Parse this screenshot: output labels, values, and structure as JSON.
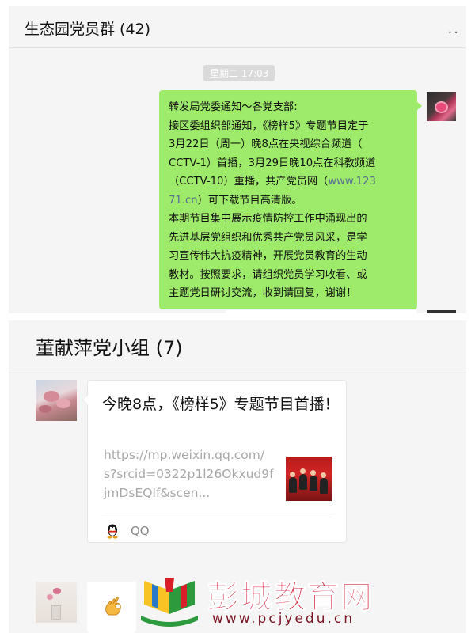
{
  "chat1": {
    "title": "生态园党员群 (42)",
    "more_label": "..",
    "time": "星期二 17:03",
    "message_lines": [
      "转发局党委通知～各党支部:",
      "接区委组织部通知，《榜样5》专题节目定于",
      "3月22日（周一）晚8点在央视综合频道（",
      "CCTV-1）首播，3月29日晚10点在科教频道",
      "（CCTV-10）重播，共产党员网（"
    ],
    "link_part1": "www.123",
    "link_part2": "71.cn",
    "message_after_link": "）可下载节目高清版。",
    "message_lines2": [
      "本期节目集中展示疫情防控工作中涌现出的",
      "先进基层党组织和优秀共产党员风采，是学",
      "习宣传伟大抗疫精神，开展党员教育的生动",
      "教材。按照要求，请组织党员学习收看、或",
      "主题党日研讨交流，收到请回复，谢谢！"
    ]
  },
  "chat2": {
    "title": "董献萍党小组 (7)",
    "card": {
      "title": "今晚8点，《榜样5》专题节目首播！",
      "url": "https://mp.weixin.qq.com/s?srcid=0322p1l26Okxud9fjmDsEQIf&scen...",
      "source_label": "QQ",
      "source_icon": "qq-penguin-icon"
    },
    "reply_icon": "ok-hand-icon"
  },
  "watermark": {
    "name": "彭城教育网",
    "url": "www.pcjyedu.cn"
  },
  "colors": {
    "bubble_green": "#9eea6a",
    "link_blue": "#576b95",
    "watermark_red": "#d0112b"
  }
}
